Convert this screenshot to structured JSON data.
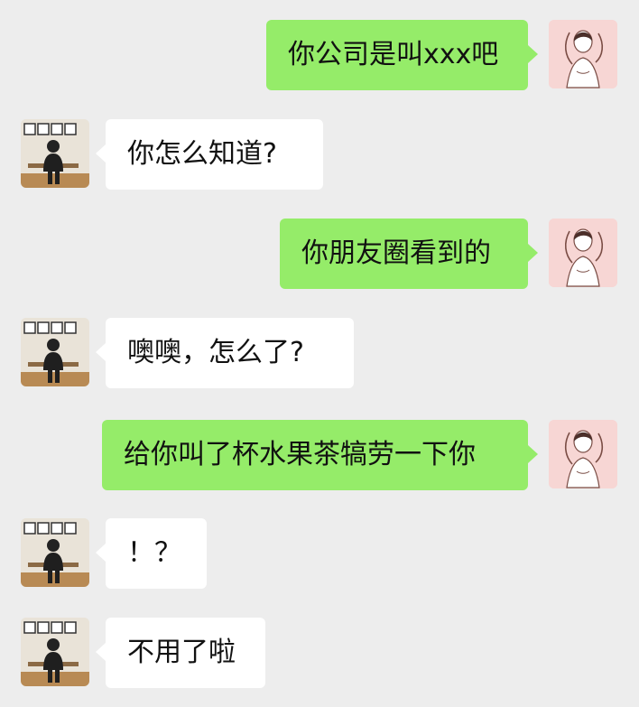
{
  "chat": {
    "messages": [
      {
        "side": "right",
        "avatar": "woman-avatar",
        "text": "你公司是叫xxx吧"
      },
      {
        "side": "left",
        "avatar": "man-avatar",
        "text": "你怎么知道?"
      },
      {
        "side": "right",
        "avatar": "woman-avatar",
        "text": "你朋友圈看到的"
      },
      {
        "side": "left",
        "avatar": "man-avatar",
        "text": "噢噢，怎么了?"
      },
      {
        "side": "right",
        "avatar": "woman-avatar",
        "text": "给你叫了杯水果茶犒劳一下你"
      },
      {
        "side": "left",
        "avatar": "man-avatar",
        "text": "！？"
      },
      {
        "side": "left",
        "avatar": "man-avatar",
        "text": "不用了啦"
      }
    ]
  },
  "colors": {
    "background": "#ededed",
    "my_bubble": "#95ec69",
    "other_bubble": "#ffffff",
    "text": "#111111"
  }
}
